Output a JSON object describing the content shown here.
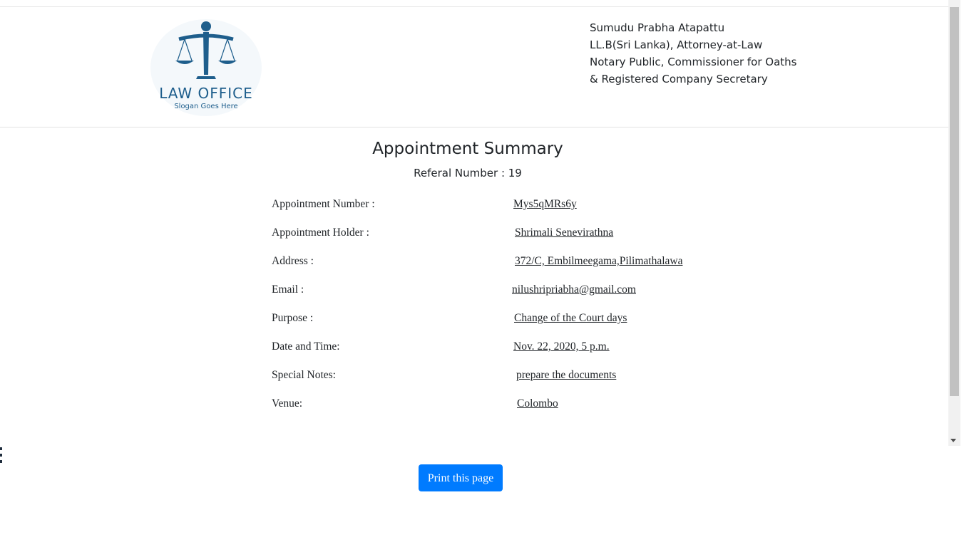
{
  "header": {
    "logo": {
      "title": "LAW OFFICE",
      "slogan": "Slogan Goes Here",
      "icon": "scales-of-justice-icon",
      "color": "#1e5e8c"
    },
    "firm_info": [
      "Sumudu Prabha Atapattu",
      "LL.B(Sri Lanka), Attorney-at-Law",
      "Notary Public, Commissioner for Oaths",
      "& Registered Company Secretary"
    ]
  },
  "summary": {
    "title": "Appointment Summary",
    "referal_text": "Referal Number : 19",
    "rows": [
      {
        "label": "Appointment Number :",
        "value": "Mys5qMRs6y"
      },
      {
        "label": "Appointment Holder :",
        "value": "Shrimali Senevirathna"
      },
      {
        "label": "Address :",
        "value": "372/C, Embilmeegama,Pilimathalawa"
      },
      {
        "label": "Email :",
        "value": "nilushripriabha@gmail.com"
      },
      {
        "label": "Purpose :",
        "value": "Change of the Court days"
      },
      {
        "label": "Date and Time:",
        "value": "Nov. 22, 2020, 5 p.m."
      },
      {
        "label": "Special Notes:",
        "value": "prepare the documents"
      },
      {
        "label": "Venue:",
        "value": "Colombo"
      }
    ]
  },
  "actions": {
    "print_label": "Print this page",
    "print_color": "#007bff"
  }
}
